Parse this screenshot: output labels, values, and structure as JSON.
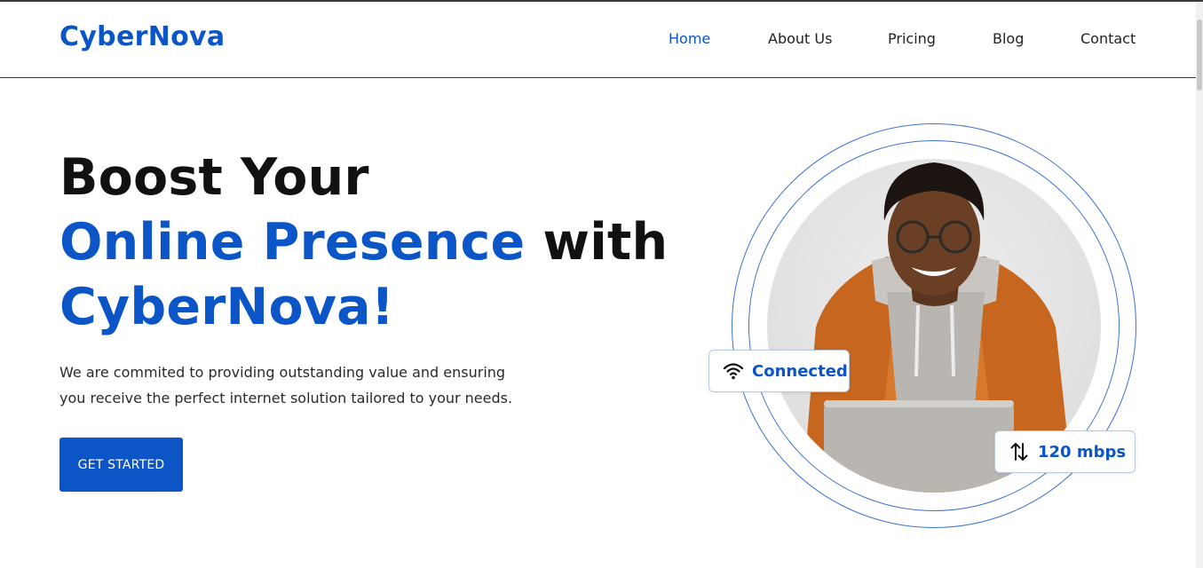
{
  "header": {
    "logo": "CyberNova",
    "nav": [
      "Home",
      "About Us",
      "Pricing",
      "Blog",
      "Contact"
    ],
    "active": "Home"
  },
  "hero": {
    "line1": "Boost Your",
    "line2_highlight": "Online Presence",
    "line2_rest": " with",
    "line3": "CyberNova!",
    "description_line1": "We are commited to providing outstanding value and ensuring",
    "description_line2": "you receive the perfect internet solution tailored to your needs.",
    "cta": "GET STARTED"
  },
  "badges": {
    "status": "Connected",
    "speed": "120 mbps"
  },
  "icons": {
    "status": "wifi-icon",
    "speed": "up-down-arrows-icon"
  },
  "colors": {
    "brand": "#0b55c6",
    "text": "#111111"
  }
}
